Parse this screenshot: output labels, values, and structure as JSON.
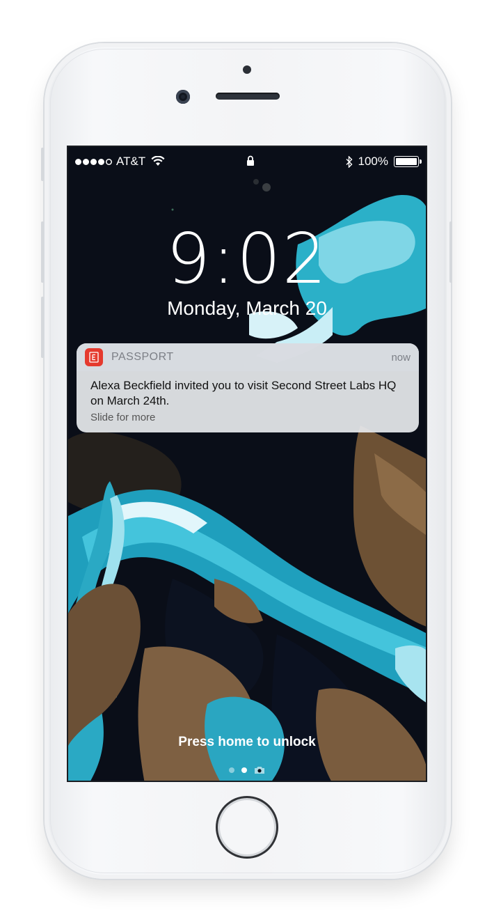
{
  "status_bar": {
    "carrier": "AT&T",
    "battery_percent": "100%",
    "battery_level": 1.0,
    "icons": [
      "signal-icon",
      "wifi-icon",
      "lock-icon",
      "bluetooth-icon",
      "battery-icon"
    ]
  },
  "lockscreen": {
    "time": "9:02",
    "date": "Monday, March 20",
    "unlock_hint": "Press home to unlock",
    "pages": 2,
    "active_page": 1
  },
  "notification": {
    "app_name": "PASSPORT",
    "time": "now",
    "message": "Alexa Beckfield invited you to visit Second Street Labs HQ on March 24th.",
    "subtext": "Slide for more",
    "icon_color": "#e53a2e"
  },
  "colors": {
    "water": "#2bb0c8",
    "ice": "#e8f7fb",
    "land": "#8a6a4a",
    "dark": "#0a0e18"
  }
}
